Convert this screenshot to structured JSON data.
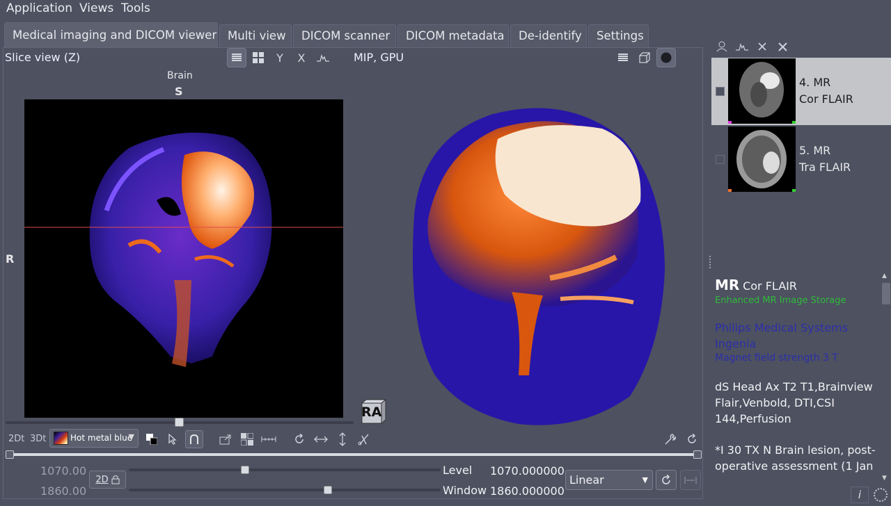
{
  "menubar": {
    "items": [
      "Application",
      "Views",
      "Tools"
    ]
  },
  "tabs": [
    {
      "label": "Medical imaging and DICOM viewer",
      "active": true
    },
    {
      "label": "Multi view",
      "active": false
    },
    {
      "label": "DICOM scanner",
      "active": false
    },
    {
      "label": "DICOM metadata",
      "active": false
    },
    {
      "label": "De-identify",
      "active": false
    },
    {
      "label": "Settings",
      "active": false
    }
  ],
  "slice_panel": {
    "title": "Slice view (Z)",
    "view_mode": "MIP, GPU",
    "toolbar": {
      "y_label": "Y",
      "x_label": "X"
    },
    "orientation_top": "S",
    "orientation_left": "R",
    "region_label": "Brain",
    "slider_position": 0.5
  },
  "cube_label": "RA",
  "bottom_toolbar": {
    "mode_2d": "2Dt",
    "mode_3d": "3Dt",
    "lut": "Hot metal blue"
  },
  "level_window": {
    "level_value": "1070.00",
    "window_value": "1860.00",
    "level_label": "Level",
    "window_label": "Window",
    "level_exact": "1070.000000",
    "window_exact": "1860.000000",
    "lock_label": "2D",
    "interpolation": "Linear"
  },
  "series": [
    {
      "index": "4. MR",
      "name": "Cor FLAIR",
      "selected": true
    },
    {
      "index": "5. MR",
      "name": "Tra FLAIR",
      "selected": false
    }
  ],
  "info": {
    "modality": "MR",
    "description": "Cor FLAIR",
    "status": "Enhanced MR Image Storage",
    "manufacturer": "Philips Medical Systems Ingenia",
    "field_strength": "Magnet field strength 3 T",
    "protocol": "dS Head Ax T2 T1,Brainview Flair,Venbold, DTI,CSI 144,Perfusion",
    "comment": "*I 30 TX N Brain lesion, post-operative assessment (1 Jan"
  },
  "colors": {
    "background": "#4d5160",
    "selected_row": "#c4c5c9",
    "status_green": "#30b93a",
    "manufacturer_blue": "#2d2fa8"
  }
}
